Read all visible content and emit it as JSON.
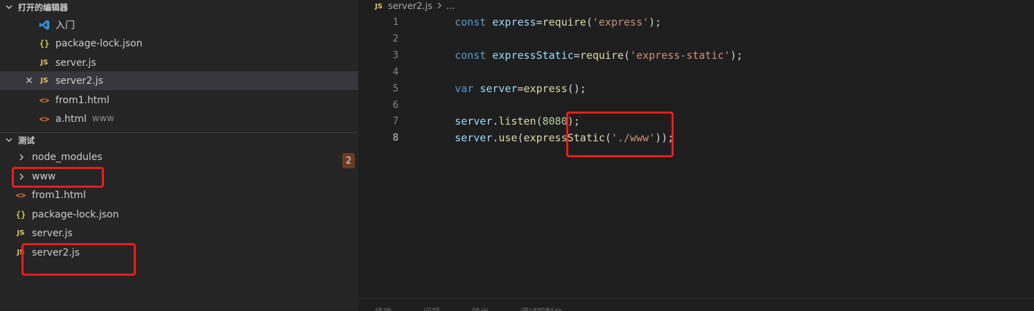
{
  "sidebar": {
    "open_editors": {
      "title": "打开的编辑器",
      "items": [
        {
          "name": "入门",
          "icon": "vscode-logo-icon"
        },
        {
          "name": "package-lock.json",
          "icon": "json-braces-icon"
        },
        {
          "name": "server.js",
          "icon": "js-icon"
        },
        {
          "name": "server2.js",
          "icon": "js-icon",
          "close": "✕"
        },
        {
          "name": "from1.html",
          "icon": "html-icon"
        },
        {
          "name": "a.html",
          "icon": "html-icon",
          "description": "www"
        }
      ]
    },
    "explorer": {
      "title": "测试",
      "items": [
        {
          "name": "node_modules",
          "icon": "chevron-right-icon"
        },
        {
          "name": "www",
          "icon": "chevron-right-icon"
        },
        {
          "name": "from1.html",
          "icon": "html-icon"
        },
        {
          "name": "package-lock.json",
          "icon": "json-braces-icon"
        },
        {
          "name": "server.js",
          "icon": "js-icon"
        },
        {
          "name": "server2.js",
          "icon": "js-icon"
        }
      ],
      "badge": "2"
    }
  },
  "editor": {
    "breadcrumb": {
      "file": "server2.js",
      "more": "..."
    },
    "lines": [
      {
        "n": "1"
      },
      {
        "n": "2"
      },
      {
        "n": "3"
      },
      {
        "n": "4"
      },
      {
        "n": "5"
      },
      {
        "n": "6"
      },
      {
        "n": "7"
      },
      {
        "n": "8"
      }
    ],
    "code": {
      "l1": {
        "kw": "const",
        "var": "express",
        "eq": "=",
        "fn": "require",
        "open": "(",
        "str": "'express'",
        "close": ");"
      },
      "l3": {
        "kw": "const",
        "var": "expressStatic",
        "eq": "=",
        "fn": "require",
        "open": "(",
        "str": "'express-static'",
        "close": ");"
      },
      "l5": {
        "kw": "var",
        "var": "server",
        "eq": "=",
        "fn": "express",
        "close": "();"
      },
      "l7": {
        "obj": "server",
        "dot": ".",
        "fn": "listen",
        "open": "(",
        "num": "8080",
        "close": ");"
      },
      "l8": {
        "obj": "server",
        "dot": ".",
        "fn": "use",
        "open": "(",
        "fn2": "expressStatic",
        "open2": "(",
        "str": "'./www'",
        "close": "));"
      }
    },
    "panel_tabs": [
      "终端",
      "问题",
      "输出",
      "调试控制台"
    ]
  },
  "colors": {
    "annotation": "#ee1c1c",
    "js": "#e8c55a",
    "html": "#e37933"
  }
}
